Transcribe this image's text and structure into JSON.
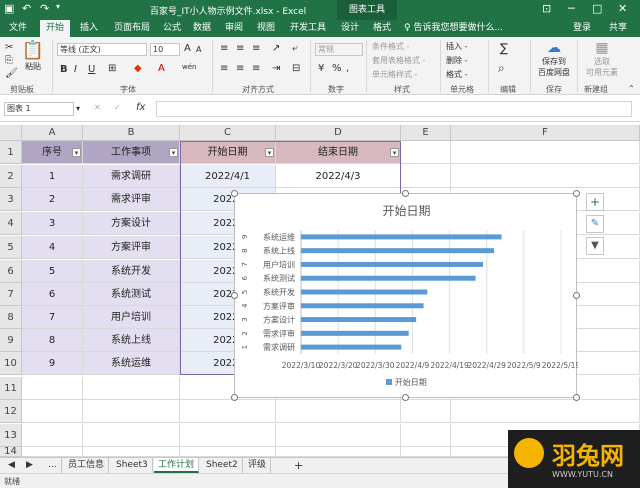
{
  "titlebar": {
    "title": "百家号_IT小人物示例文件.xlsx - Excel",
    "context_tab": "图表工具",
    "save_icon": "save-icon",
    "undo_icon": "undo-icon",
    "redo_icon": "redo-icon"
  },
  "ribbon_tabs": [
    "文件",
    "开始",
    "插入",
    "页面布局",
    "公式",
    "数据",
    "审阅",
    "视图",
    "开发工具",
    "设计",
    "格式"
  ],
  "ribbon_tab_extra": {
    "tell_me": "♀ 告诉我您想要做什么...",
    "login": "登录",
    "share": "共享"
  },
  "ribbon": {
    "clipboard": {
      "paste": "粘贴",
      "label": "剪贴板"
    },
    "font": {
      "font_name": "等线 (正文)",
      "font_size": "10",
      "bold": "B",
      "italic": "I",
      "underline": "U",
      "grow": "A",
      "shrink": "A",
      "label": "字体",
      "wen": "wén"
    },
    "align": {
      "label": "对齐方式"
    },
    "number": {
      "format": "常规",
      "pct": "%",
      "comma": ",",
      "label": "数字"
    },
    "styles": {
      "cond": "条件格式 -",
      "table": "套用表格格式 -",
      "cell": "单元格样式 -",
      "label": "样式"
    },
    "cells": {
      "insert": "插入 -",
      "delete": "删除 -",
      "format": "格式 -",
      "label": "单元格"
    },
    "edit": {
      "label": "编辑",
      "sigma": "∑"
    },
    "save": {
      "line1": "保存到",
      "line2": "百度网盘",
      "label": "保存"
    },
    "new": {
      "line1": "选取",
      "line2": "可用元素",
      "label": "新建组"
    }
  },
  "formulabar": {
    "namebox": "图表 1",
    "fx": "fx",
    "cancel": "✕",
    "confirm": "✓"
  },
  "columns": [
    "A",
    "B",
    "C",
    "D",
    "E",
    "F"
  ],
  "rows": [
    "1",
    "2",
    "3",
    "4",
    "5",
    "6",
    "7",
    "8",
    "9",
    "10",
    "11",
    "12",
    "13",
    "14"
  ],
  "table": {
    "headers": [
      "序号",
      "工作事项",
      "开始日期",
      "结束日期"
    ],
    "data": [
      [
        "1",
        "需求调研",
        "2022/4/1",
        "2022/4/3"
      ],
      [
        "2",
        "需求评审",
        "2022/",
        ""
      ],
      [
        "3",
        "方案设计",
        "2022/",
        ""
      ],
      [
        "4",
        "方案评审",
        "2022/",
        ""
      ],
      [
        "5",
        "系统开发",
        "2022/",
        ""
      ],
      [
        "6",
        "系统测试",
        "2022/",
        ""
      ],
      [
        "7",
        "用户培训",
        "2022/",
        ""
      ],
      [
        "8",
        "系统上线",
        "2022/",
        ""
      ],
      [
        "9",
        "系统运维",
        "2022/",
        ""
      ]
    ]
  },
  "chart_data": {
    "type": "bar",
    "title": "开始日期",
    "categories": [
      "需求调研",
      "需求评审",
      "方案设计",
      "方案评审",
      "系统开发",
      "系统测试",
      "用户培训",
      "系统上线",
      "系统运维"
    ],
    "category_numbers": [
      "1",
      "2",
      "3",
      "4",
      "5",
      "6",
      "7",
      "8",
      "9"
    ],
    "series": [
      {
        "name": "开始日期",
        "values": [
          "2022/4/6",
          "2022/4/8",
          "2022/4/10",
          "2022/4/12",
          "2022/4/13",
          "2022/4/26",
          "2022/4/28",
          "2022/5/1",
          "2022/5/3"
        ]
      }
    ],
    "x_ticks": [
      "2022/3/10",
      "2022/3/20",
      "2022/3/30",
      "2022/4/9",
      "2022/4/19",
      "2022/4/29",
      "2022/5/9",
      "2022/5/19"
    ],
    "xlim": [
      "2022/3/10",
      "2022/5/19"
    ],
    "legend": "bottom",
    "grid": true,
    "bar_color": "#5b9bd5"
  },
  "chart_side_buttons": [
    "plus-icon",
    "brush-icon",
    "filter-icon"
  ],
  "sheets": {
    "nav": [
      "◀",
      "▶",
      "..."
    ],
    "tabs": [
      "员工信息",
      "Sheet3",
      "工作计划",
      "Sheet2",
      "评级"
    ],
    "active": "工作计划",
    "add": "+"
  },
  "status": {
    "ready": "就绪",
    "url": "WWW.YUTU.CN"
  },
  "logo": {
    "brand": "羽兔网"
  }
}
